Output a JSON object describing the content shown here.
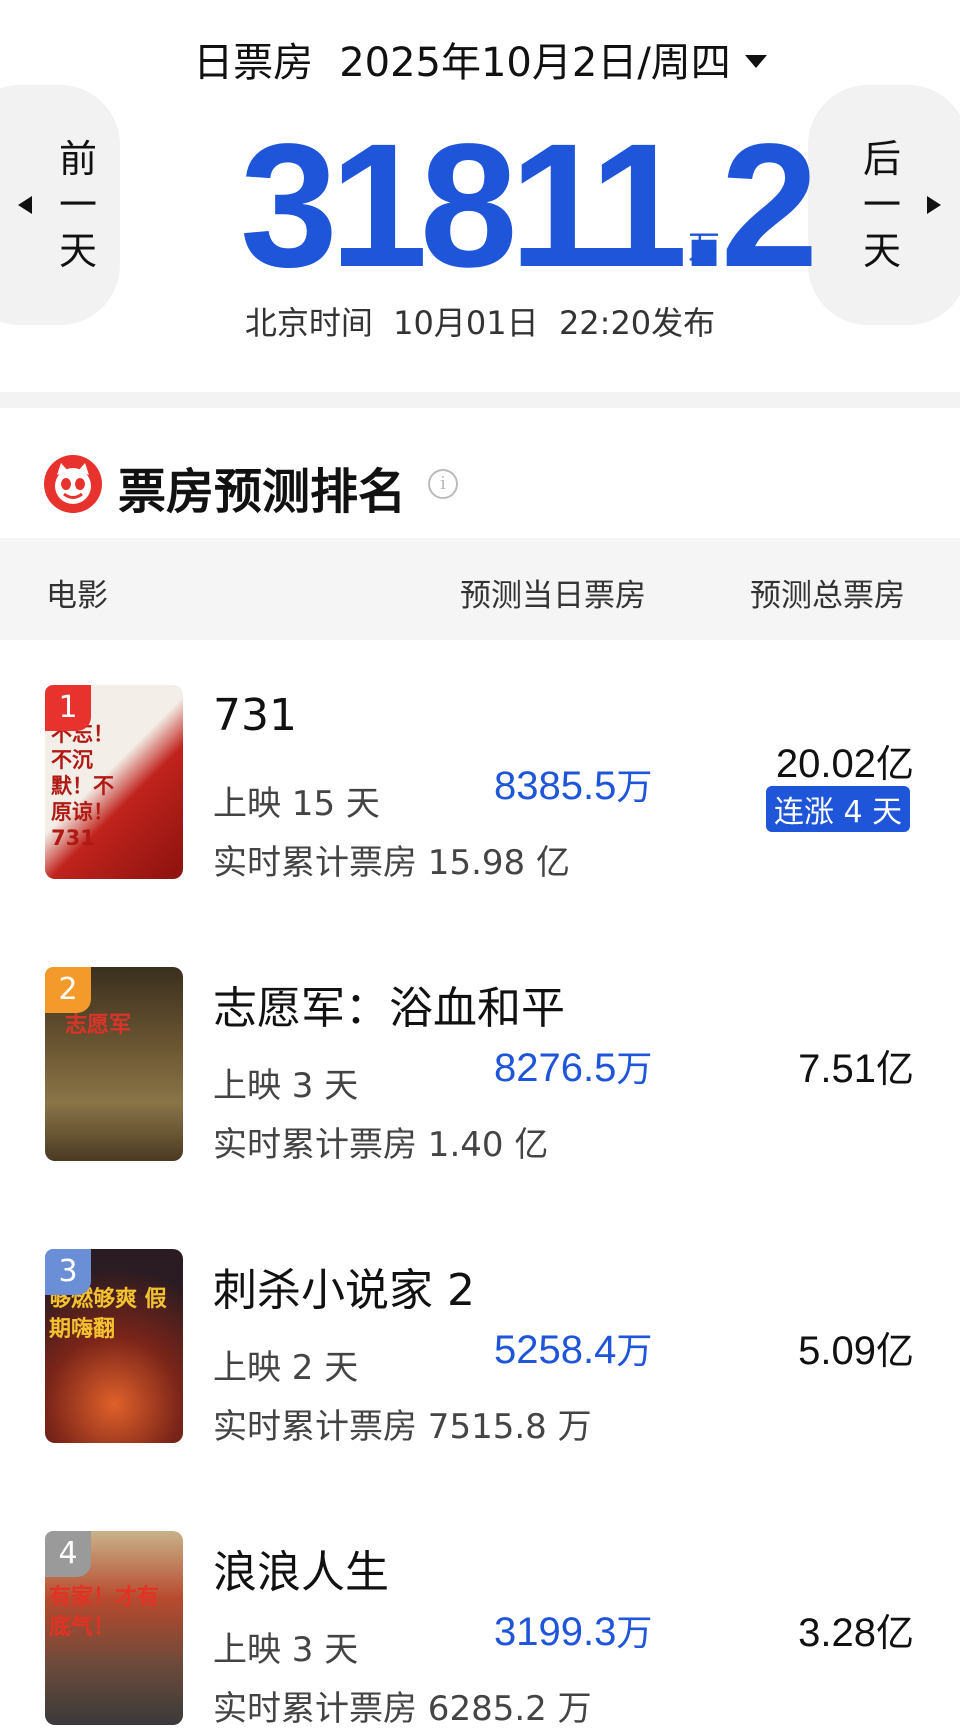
{
  "header": {
    "label": "日票房",
    "date": "2025年10月2日/周四",
    "prev_label": "前\n一\n天",
    "next_label": "后\n一\n天",
    "total": "31811.2",
    "unit": "万",
    "publish": "北京时间  10月01日  22:20发布"
  },
  "section": {
    "title": "票房预测排名",
    "info": "i"
  },
  "columns": {
    "movie": "电影",
    "today": "预测当日票房",
    "total": "预测总票房"
  },
  "colors": {
    "accent": "#1e55d9",
    "rank1": "#e8322e",
    "rank2": "#f39a2b",
    "rank3": "#6b8fd6",
    "rank4": "#9a9a9a"
  },
  "movies": [
    {
      "rank": "1",
      "name": "731",
      "days": "上映 15 天",
      "today": "8385.5",
      "today_unit": "万",
      "total": "20.02",
      "total_unit": "亿",
      "cumulative": "实时累计票房 15.98 亿",
      "badge": "连涨 4 天",
      "poster_text": "不忘！不沉默！不原谅！ 731"
    },
    {
      "rank": "2",
      "name": "志愿军：浴血和平",
      "days": "上映 3 天",
      "today": "8276.5",
      "today_unit": "万",
      "total": "7.51",
      "total_unit": "亿",
      "cumulative": "实时累计票房 1.40 亿",
      "poster_text": "志愿军"
    },
    {
      "rank": "3",
      "name": "刺杀小说家 2",
      "days": "上映 2 天",
      "today": "5258.4",
      "today_unit": "万",
      "total": "5.09",
      "total_unit": "亿",
      "cumulative": "实时累计票房 7515.8 万",
      "poster_text": "够燃够爽 假期嗨翻"
    },
    {
      "rank": "4",
      "name": "浪浪人生",
      "days": "上映 3 天",
      "today": "3199.3",
      "today_unit": "万",
      "total": "3.28",
      "total_unit": "亿",
      "cumulative": "实时累计票房 6285.2 万",
      "poster_text": "有家！才有底气！"
    }
  ]
}
